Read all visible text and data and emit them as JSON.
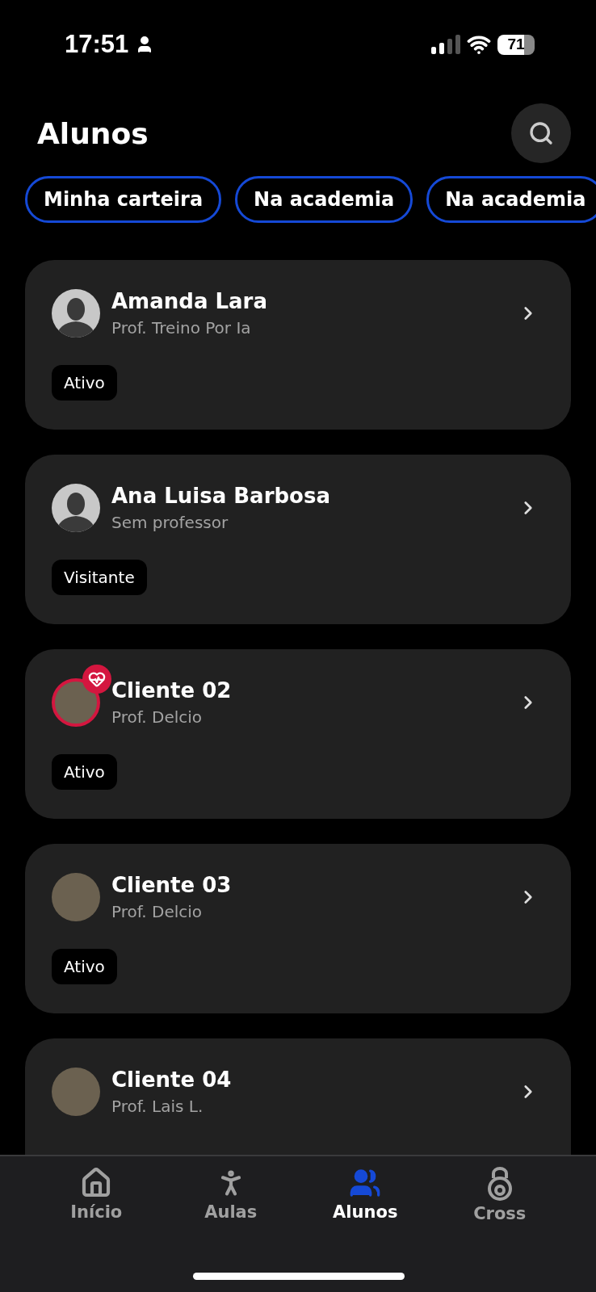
{
  "status_bar": {
    "time": "17:51",
    "battery": "71"
  },
  "header": {
    "title": "Alunos"
  },
  "filters": [
    {
      "label": "Minha carteira"
    },
    {
      "label": "Na academia"
    },
    {
      "label": "Na academia"
    }
  ],
  "students": [
    {
      "name": "Amanda Lara",
      "teacher": "Prof. Treino Por Ia",
      "status": "Ativo",
      "kind": "silhouette",
      "health_badge": false
    },
    {
      "name": "Ana Luisa Barbosa",
      "teacher": "Sem professor",
      "status": "Visitante",
      "kind": "silhouette",
      "health_badge": false
    },
    {
      "name": "Cliente 02",
      "teacher": "Prof. Delcio",
      "status": "Ativo",
      "kind": "photo",
      "health_badge": true
    },
    {
      "name": "Cliente 03",
      "teacher": "Prof. Delcio",
      "status": "Ativo",
      "kind": "photo",
      "health_badge": false
    },
    {
      "name": "Cliente 04",
      "teacher": "Prof. Lais L.",
      "kind": "photo",
      "health_badge": false
    }
  ],
  "tab_bar": [
    {
      "label": "Início",
      "selected": false
    },
    {
      "label": "Aulas",
      "selected": false
    },
    {
      "label": "Alunos",
      "selected": true
    },
    {
      "label": "Cross",
      "selected": false
    }
  ]
}
